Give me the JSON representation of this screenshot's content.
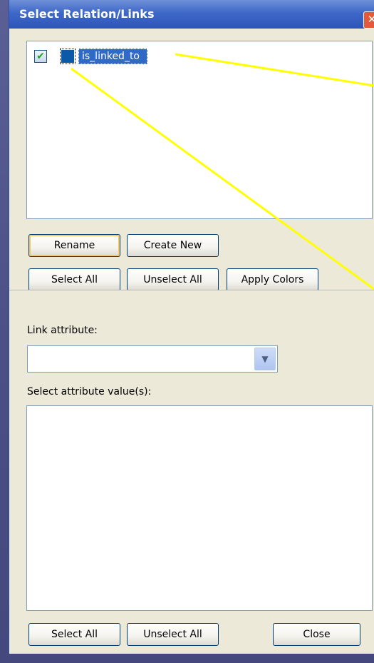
{
  "window": {
    "title": "Select Relation/Links",
    "close_glyph": "✕"
  },
  "relations": {
    "items": [
      {
        "label": "is_linked_to",
        "checked": true,
        "check_glyph": "✔",
        "color": "#0b5aa9"
      }
    ]
  },
  "relation_buttons": {
    "rename": "Rename",
    "create_new": "Create New",
    "select_all": "Select All",
    "unselect_all": "Unselect All",
    "apply_colors": "Apply Colors"
  },
  "attribute": {
    "link_attribute_label": "Link attribute:",
    "link_attribute_value": "",
    "dropdown_glyph": "▼",
    "values_label": "Select attribute value(s):",
    "values": []
  },
  "bottom_buttons": {
    "select_all": "Select All",
    "unselect_all": "Unselect All",
    "close": "Close"
  },
  "colors": {
    "annotation_line": "#ffff00",
    "selection": "#316ac5"
  }
}
